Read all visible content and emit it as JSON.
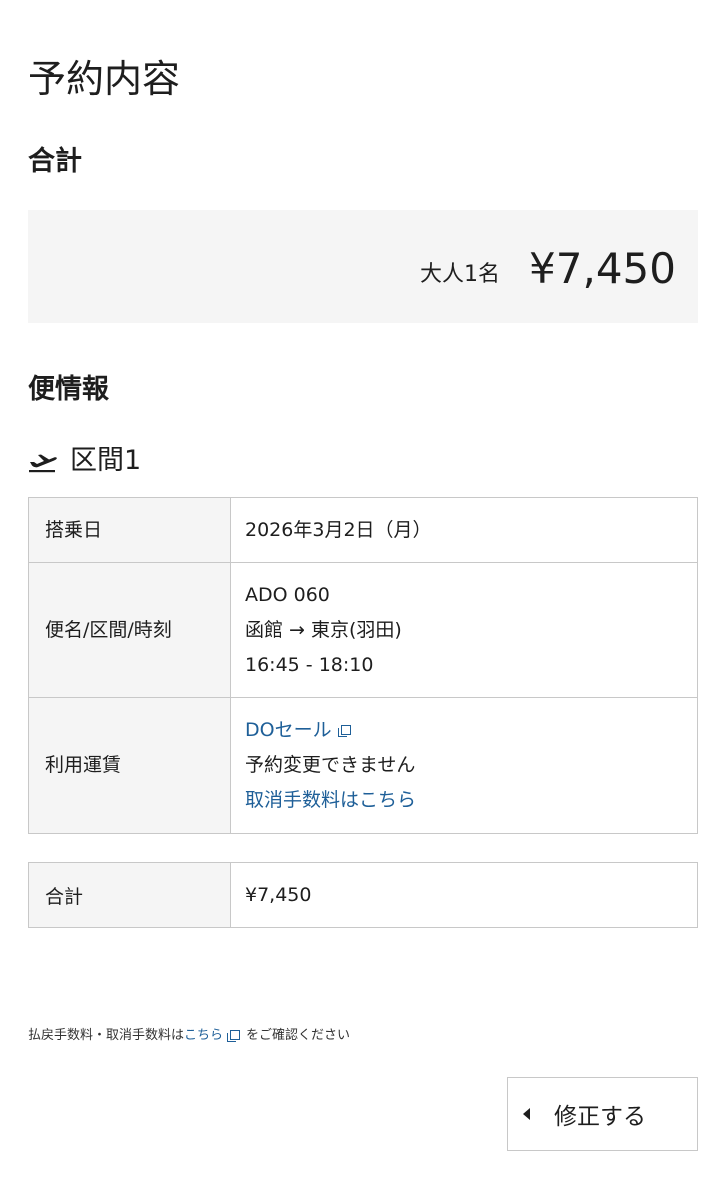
{
  "page": {
    "title": "予約内容"
  },
  "total": {
    "heading": "合計",
    "pax": "大人1名",
    "amount": "¥7,450"
  },
  "flight": {
    "heading": "便情報",
    "segment_label": "区間1",
    "rows": {
      "date": {
        "label": "搭乗日",
        "value": "2026年3月2日（月）"
      },
      "flight": {
        "label": "便名/区間/時刻",
        "number": "ADO 060",
        "route": "函館 → 東京(羽田)",
        "time": "16:45 - 18:10"
      },
      "fare": {
        "label": "利用運賃",
        "name": "DOセール",
        "note": "予約変更できません",
        "cancel_link": "取消手数料はこちら"
      }
    }
  },
  "summary": {
    "label": "合計",
    "value": "¥7,450"
  },
  "footnote": {
    "prefix": "払戻手数料・取消手数料は",
    "link": "こちら",
    "suffix": "をご確認ください"
  },
  "actions": {
    "edit_label": "修正する"
  },
  "colors": {
    "link": "#1e5f98",
    "panel_bg": "#f5f5f5",
    "border": "#c8c8c8"
  },
  "icons": {
    "segment": "airplane-takeoff-icon",
    "external": "external-link-icon",
    "back": "triangle-left-icon"
  }
}
